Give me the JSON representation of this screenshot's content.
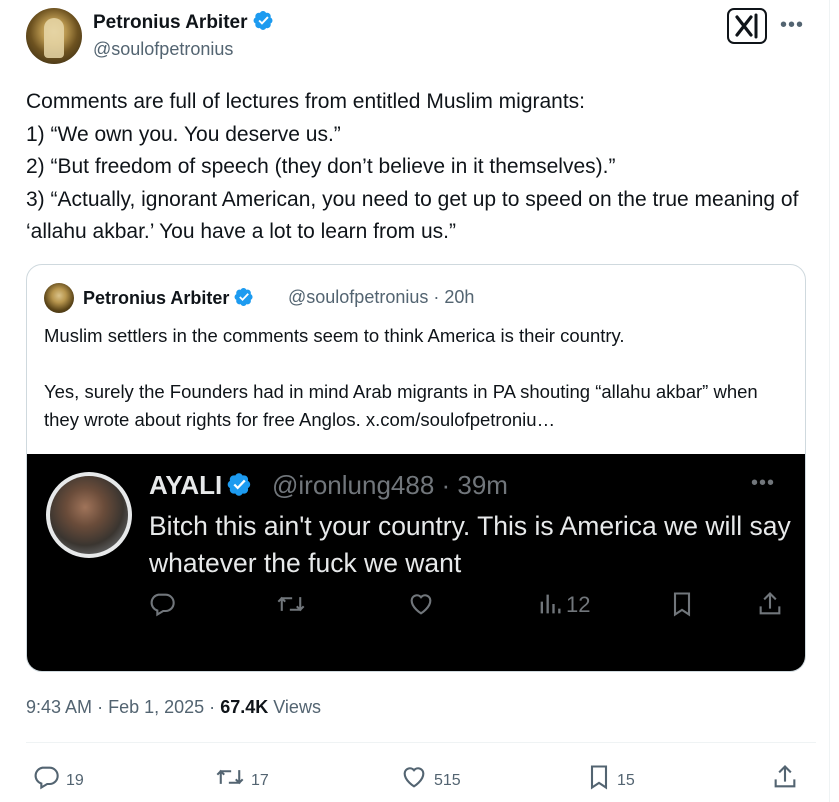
{
  "author": {
    "name": "Petronius Arbiter",
    "handle": "@soulofpetronius"
  },
  "post": {
    "text": "Comments are full of lectures from entitled Muslim migrants:\n1) “We own you. You deserve us.”\n2) “But freedom of speech (they don’t believe in it themselves).”\n3) “Actually, ignorant American, you need to get up to speed on the true meaning of ‘allahu akbar.’ You have a lot to learn from us.”",
    "time": "9:43 AM",
    "date": "Feb 1, 2025",
    "views_count": "67.4K",
    "views_label": "Views",
    "separator": "·"
  },
  "quote": {
    "name": "Petronius Arbiter",
    "handle_time": "@soulofpetronius · 20h",
    "text": "Muslim settlers in the comments seem to think America is their country.\n\nYes, surely the Founders had in mind Arab migrants in PA shouting  “allahu akbar” when they wrote about rights for free Anglos.  x.com/soulofpetroniu…"
  },
  "embedded": {
    "name": "AYALI",
    "handle_time": "@ironlung488 · 39m",
    "text": "Bitch this ain't your country. This is America we will say whatever the fuck we want",
    "views": "12",
    "more": "•••"
  },
  "actions": {
    "replies": "19",
    "reposts": "17",
    "likes": "515",
    "bookmarks": "15"
  },
  "header": {
    "more": "•••"
  },
  "colors": {
    "verified": "#1d9bf0",
    "text": "#0f1419",
    "secondary": "#536471"
  }
}
